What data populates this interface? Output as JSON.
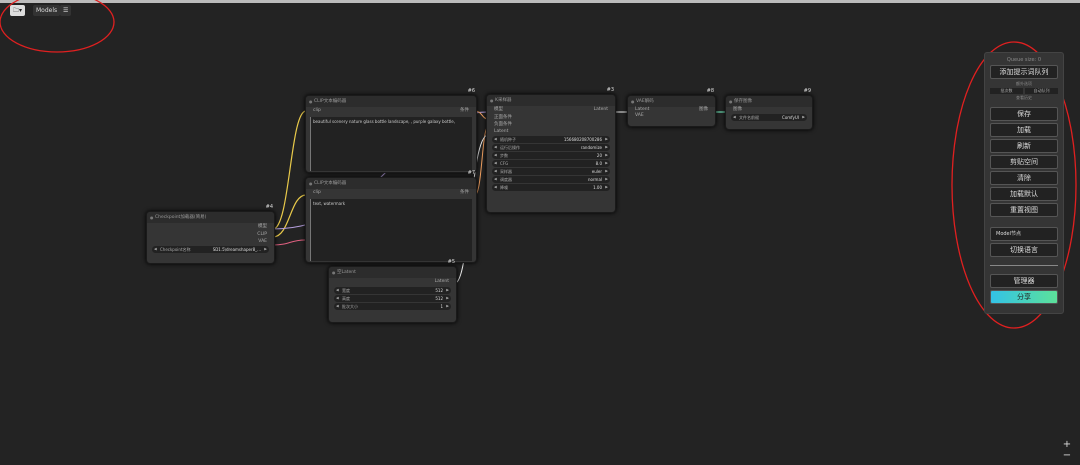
{
  "toolbar": {
    "workflow_icon": "folder-icon",
    "models_label": "Models",
    "menu_icon": "list-icon"
  },
  "nodes": {
    "checkpoint": {
      "id": "#4",
      "title": "Checkpoint加载器(简易)",
      "outputs": [
        "模型",
        "CLIP",
        "VAE"
      ],
      "widget_label": "Checkpoint名称",
      "widget_value": "SD1.5\\dreamshaper8_..."
    },
    "pos_clip": {
      "id": "#6",
      "title": "CLIP文本编码器",
      "input": "clip",
      "output": "条件",
      "text": "beautiful scenery nature glass bottle landscape, , purple galaxy bottle,"
    },
    "neg_clip": {
      "id": "#7",
      "title": "CLIP文本编码器",
      "input": "clip",
      "output": "条件",
      "text": "text, watermark"
    },
    "latent": {
      "id": "#5",
      "title": "空Latent",
      "output": "Latent",
      "widgets": [
        {
          "label": "宽度",
          "value": "512"
        },
        {
          "label": "高度",
          "value": "512"
        },
        {
          "label": "批次大小",
          "value": "1"
        }
      ]
    },
    "ksampler": {
      "id": "#3",
      "title": "K采样器",
      "inputs": [
        "模型",
        "正面条件",
        "负面条件",
        "Latent"
      ],
      "output": "Latent",
      "widgets": [
        {
          "label": "随机种子",
          "value": "156680208700286"
        },
        {
          "label": "运行后操作",
          "value": "randomize"
        },
        {
          "label": "步数",
          "value": "20"
        },
        {
          "label": "CFG",
          "value": "8.0"
        },
        {
          "label": "采样器",
          "value": "euler"
        },
        {
          "label": "调度器",
          "value": "normal"
        },
        {
          "label": "降噪",
          "value": "1.00"
        }
      ]
    },
    "vae": {
      "id": "#8",
      "title": "VAE解码",
      "inputs": [
        "Latent",
        "VAE"
      ],
      "output": "图像"
    },
    "save": {
      "id": "#9",
      "title": "保存图像",
      "input": "图像",
      "widget_label": "文件名前缀",
      "widget_value": "ComfyUI"
    }
  },
  "menu": {
    "title": "Queue size: 0",
    "queue": "添加提示词队列",
    "extra": "额外选项",
    "opt1": "批次数",
    "opt2": "自动队列",
    "history": "查看历史",
    "save": "保存",
    "load": "加载",
    "refresh": "刷新",
    "clipspace": "剪贴空间",
    "clear": "清除",
    "load_default": "加载默认",
    "reset_view": "重置视图",
    "model_node": "Model节点",
    "switch_lang": "切换语言",
    "manager": "管理器",
    "share": "分享"
  },
  "zoom": {
    "plus": "+",
    "minus": "−"
  },
  "colors": {
    "annotation": "#e02020",
    "share_start": "#33c2e6",
    "share_end": "#5ce19a"
  }
}
